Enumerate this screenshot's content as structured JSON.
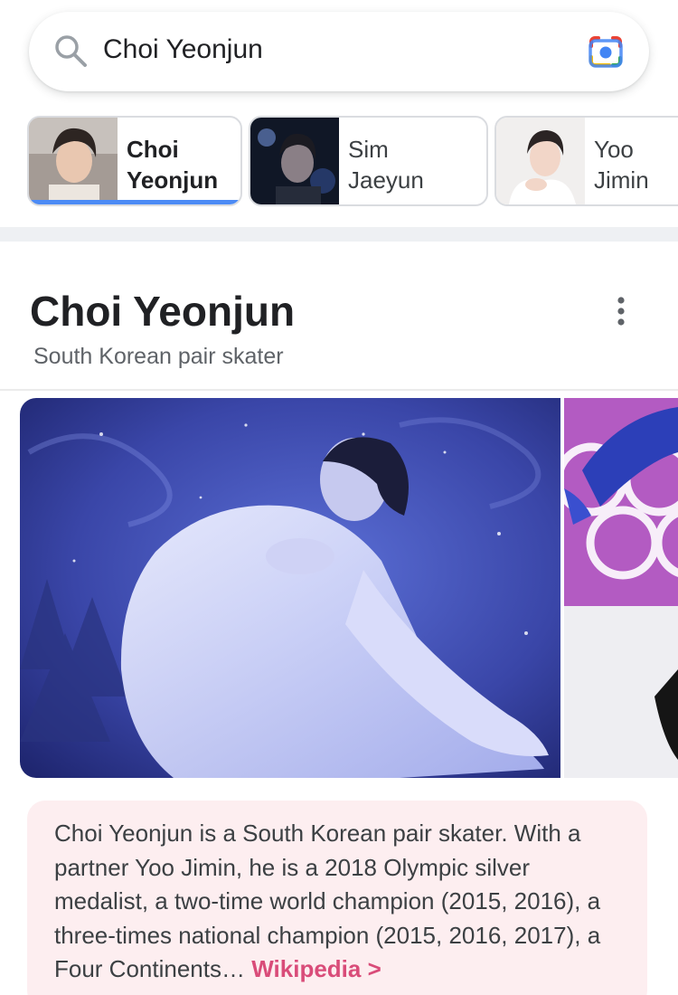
{
  "search": {
    "query": "Choi Yeonjun",
    "icons": {
      "left": "search-icon",
      "right": "google-lens-icon"
    }
  },
  "chips": [
    {
      "line1": "Choi",
      "line2": "Yeonjun",
      "selected": true
    },
    {
      "line1": "Sim",
      "line2": "Jaeyun",
      "selected": false
    },
    {
      "line1": "Yoo",
      "line2": "Jimin",
      "selected": false
    }
  ],
  "knowledge_panel": {
    "title": "Choi Yeonjun",
    "subtitle": "South Korean pair skater",
    "menu_icon": "more-vert-icon",
    "description": "Choi Yeonjun is a South Korean pair skater. With a partner Yoo Jimin, he is a 2018 Olympic silver medalist, a two-time world champion (2015, 2016), a three-times national champion (2015, 2016, 2017), a Four Continents…",
    "source_link": "Wikipedia >"
  },
  "colors": {
    "accent_blue": "#4c8bf5",
    "card_pink": "#fdeef0",
    "link_pink": "#d94c79"
  }
}
